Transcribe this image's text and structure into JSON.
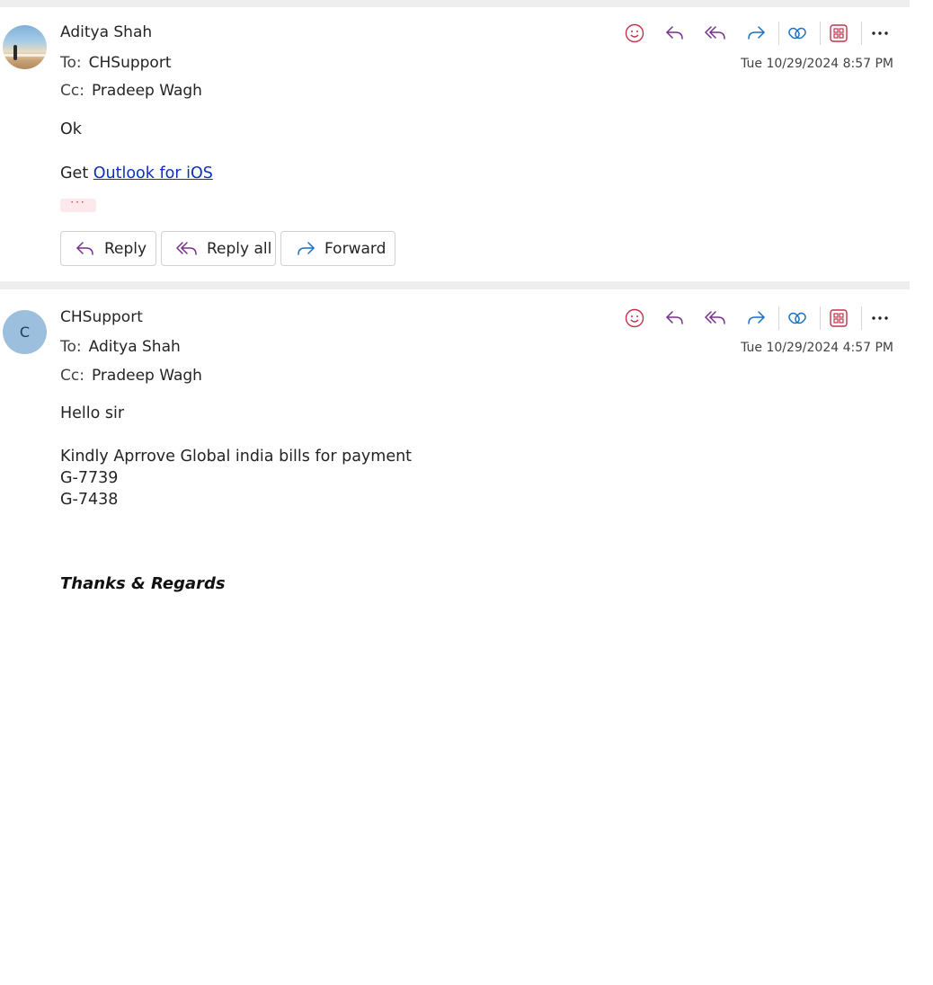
{
  "messages": [
    {
      "sender": "Aditya Shah",
      "to_label": "To:",
      "to": "CHSupport",
      "cc_label": "Cc:",
      "cc": "Pradeep Wagh",
      "date": "Tue 10/29/2024 8:57 PM",
      "body_line1": "Ok",
      "body_get": "Get ",
      "body_link": "Outlook for iOS",
      "more_dots": "···",
      "buttons": {
        "reply": "Reply",
        "reply_all": "Reply all",
        "forward": "Forward"
      }
    },
    {
      "sender": "CHSupport",
      "avatar_initial": "C",
      "to_label": "To:",
      "to": "Aditya Shah",
      "cc_label": "Cc:",
      "cc": "Pradeep Wagh",
      "date": "Tue 10/29/2024 4:57 PM",
      "body_greeting": "Hello sir",
      "body_line1": "Kindly Aprrove Global india bills for payment",
      "body_line2": "G-7739",
      "body_line3": "G-7438",
      "signature": "Thanks & Regards"
    }
  ],
  "icons": [
    "smile-icon",
    "reply-icon",
    "reply-all-icon",
    "forward-icon",
    "loop-icon",
    "apps-icon",
    "more-icon"
  ],
  "colors": {
    "icon_red": "#c4314b",
    "icon_purple": "#7a2d8c",
    "icon_blue": "#1a6fc4",
    "link": "#0f2fc0"
  }
}
